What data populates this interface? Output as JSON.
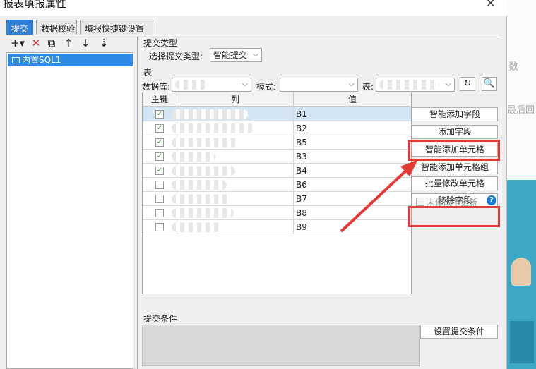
{
  "window": {
    "title": "报表填报属性",
    "close_glyph": "×"
  },
  "tabs": [
    {
      "label": "提交"
    },
    {
      "label": "数据校验"
    },
    {
      "label": "填报快捷键设置"
    }
  ],
  "toolbar": {
    "add": "+▾",
    "delete": "✕",
    "copy": "⧉",
    "up": "↑",
    "down": "↓",
    "sort": "⇣"
  },
  "tree": {
    "items": [
      {
        "label": "内置SQL1"
      }
    ]
  },
  "submit_type": {
    "section_label": "提交类型",
    "field_label": "选择提交类型:",
    "value": "智能提交"
  },
  "table_section": {
    "section_label": "表",
    "database_label": "数据库:",
    "schema_label": "模式:",
    "table_label": "表:",
    "refresh_glyph": "↻",
    "preview_glyph": "🔍"
  },
  "values_section": {
    "section_label": "值",
    "headers": {
      "key": "主键",
      "column": "列",
      "value": "值"
    },
    "rows": [
      {
        "key": true,
        "value": "B1",
        "selected": true
      },
      {
        "key": true,
        "value": "B2",
        "selected": false
      },
      {
        "key": true,
        "value": "B5",
        "selected": false
      },
      {
        "key": true,
        "value": "B3",
        "selected": false
      },
      {
        "key": true,
        "value": "B4",
        "selected": false
      },
      {
        "key": false,
        "value": "B6",
        "selected": false
      },
      {
        "key": false,
        "value": "B7",
        "selected": false
      },
      {
        "key": false,
        "value": "B8",
        "selected": false
      },
      {
        "key": false,
        "value": "B9",
        "selected": false
      }
    ]
  },
  "side_buttons": {
    "smart_add_field": "智能添加字段",
    "add_field": "添加字段",
    "smart_add_cell": "智能添加单元格",
    "smart_add_cell_group": "智能添加单元格组",
    "batch_modify_cell": "批量修改单元格",
    "remove_field": "移除字段",
    "no_update_unmodified": "未修改不更新",
    "help": "?"
  },
  "condition": {
    "section_label": "提交条件",
    "set_button": "设置提交条件"
  },
  "background": {
    "text1": "数",
    "text2": "最后回"
  },
  "colors": {
    "accent": "#2f7fd6",
    "highlight": "#e53935",
    "selected_row": "#d4e5f3",
    "check": "#2a8a2a"
  }
}
